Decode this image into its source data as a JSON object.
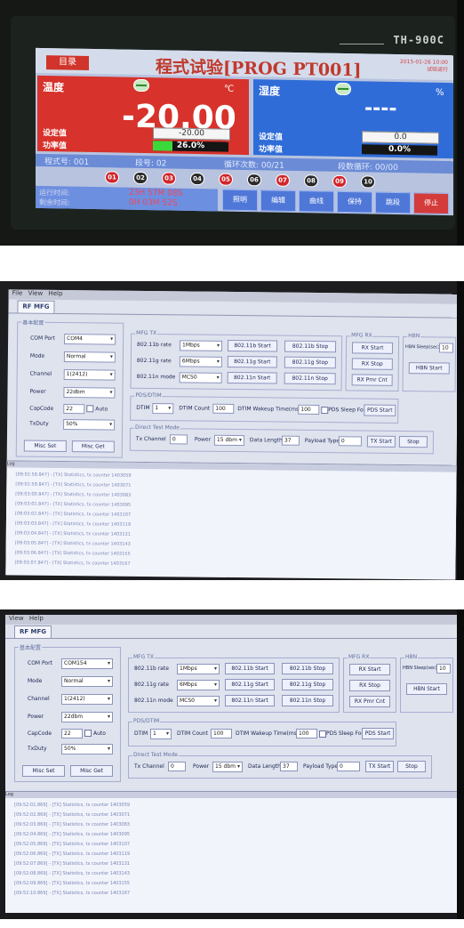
{
  "photo1": {
    "model": "TH-900C",
    "menu_btn": "目录",
    "title": "程式试验[PROG PT001]",
    "date_line1": "2015-01-26 10:00",
    "date_line2": "试验运行",
    "temp_label": "温度",
    "temp_value": "-20.00",
    "temp_unit": "℃",
    "temp_set_label": "设定值",
    "temp_set_value": "-20.00",
    "temp_power_label": "功率值",
    "temp_power_value": "26.0%",
    "temp_power_fraction": 0.26,
    "hum_label": "湿度",
    "hum_value": "----",
    "hum_unit": "%",
    "hum_set_label": "设定值",
    "hum_set_value": "0.0",
    "hum_power_label": "功率值",
    "hum_power_value": "0.0%",
    "program_no": "程式号: 001",
    "segment_no": "段号: 02",
    "cycle_count": "循环次数: 00/21",
    "segment_cycle": "段数循环: 00/00",
    "circles": [
      "01",
      "02",
      "03",
      "04",
      "05",
      "06",
      "07",
      "08",
      "09",
      "10"
    ],
    "run_time_label": "运行时间:",
    "run_time_value": "23H 57M 08S",
    "remain_time_label": "剩余时间:",
    "remain_time_value": "0H 03M 52S",
    "buttons": [
      "照明",
      "编辑",
      "曲线",
      "保持",
      "跳段",
      "停止"
    ]
  },
  "photo2": {
    "menu": [
      "File",
      "View",
      "Help"
    ],
    "tab": "RF MFG",
    "basic_group": "基本配置",
    "com_port_label": "COM Port",
    "com_port": "COM4",
    "mode_label": "Mode",
    "mode": "Normal",
    "channel_label": "Channel",
    "channel": "1(2412)",
    "power_label": "Power",
    "power": "22dbm",
    "capcode_label": "CapCode",
    "capcode": "22",
    "auto_label": "Auto",
    "txduty_label": "TxDuty",
    "txduty": "50%",
    "misc_set": "Misc Set",
    "misc_get": "Misc Get",
    "mfg_tx_group": "MFG TX",
    "rate_11b_label": "802.11b rate",
    "rate_11b": "1Mbps",
    "rate_11g_label": "802.11g rate",
    "rate_11g": "6Mbps",
    "mode_11n_label": "802.11n mode",
    "mode_11n": "MCS0",
    "b_start": "802.11b Start",
    "b_stop": "802.11b Stop",
    "g_start": "802.11g Start",
    "g_stop": "802.11g Stop",
    "n_start": "802.11n Start",
    "n_stop": "802.11n Stop",
    "mfg_rx_group": "MFG RX",
    "rx_start": "RX Start",
    "rx_stop": "RX Stop",
    "rx_pmcnt": "RX Pmr Cnt",
    "hbn_group": "HBN",
    "hbn_sleep_label": "HBN Sleep(sec)",
    "hbn_sleep": "10",
    "hbn_start": "HBN Start",
    "pds_group": "PDS/DTIM",
    "dtim_label": "DTIM",
    "dtim": "1",
    "dtim_count_label": "DTIM Count",
    "dtim_count": "100",
    "dtim_wakeup_label": "DTIM Wakeup Time(ms)",
    "dtim_wakeup": "100",
    "pds_sleep_forever_label": "PDS Sleep Forever",
    "pds_start": "PDS Start",
    "direct_group": "Direct Test Mode",
    "tx_channel_label": "Tx Channel",
    "tx_channel": "0",
    "dtm_power_label": "Power",
    "dtm_power": "15 dbm",
    "data_length_label": "Data Length",
    "data_length": "37",
    "payload_label": "Payload Type",
    "payload": "0",
    "tx_start": "TX Start",
    "stop": "Stop",
    "log_head": "Log",
    "log_lines": [
      "[09:02:58.847] - [TX] Statistics, tx counter 1403059",
      "[09:02:59.847] - [TX] Statistics, tx counter 1403071",
      "[09:03:00.847] - [TX] Statistics, tx counter 1403083",
      "[09:03:01.847] - [TX] Statistics, tx counter 1403095",
      "[09:03:02.847] - [TX] Statistics, tx counter 1403107",
      "[09:03:03.847] - [TX] Statistics, tx counter 1403119",
      "[09:03:04.847] - [TX] Statistics, tx counter 1403131",
      "[09:03:05.847] - [TX] Statistics, tx counter 1403143",
      "[09:03:06.847] - [TX] Statistics, tx counter 1403155",
      "[09:03:07.847] - [TX] Statistics, tx counter 1403167"
    ]
  },
  "photo3": {
    "menu": [
      "View",
      "Help"
    ],
    "tab": "RF MFG",
    "basic_group": "基本配置",
    "com_port": "COM154",
    "mode": "Normal",
    "channel": "1(2412)",
    "power": "22dbm",
    "capcode": "22",
    "txduty": "50%",
    "hbn_sleep": "10",
    "log_lines": [
      "[09:52:01.869] - [TX] Statistics, tx counter 1403059",
      "[09:52:02.869] - [TX] Statistics, tx counter 1403071",
      "[09:52:03.869] - [TX] Statistics, tx counter 1403083",
      "[09:52:04.869] - [TX] Statistics, tx counter 1403095",
      "[09:52:05.869] - [TX] Statistics, tx counter 1403107",
      "[09:52:06.869] - [TX] Statistics, tx counter 1403119",
      "[09:52:07.869] - [TX] Statistics, tx counter 1403131",
      "[09:52:08.869] - [TX] Statistics, tx counter 1403143",
      "[09:52:09.869] - [TX] Statistics, tx counter 1403155",
      "[09:52:10.869] - [TX] Statistics, tx counter 1403167"
    ]
  }
}
